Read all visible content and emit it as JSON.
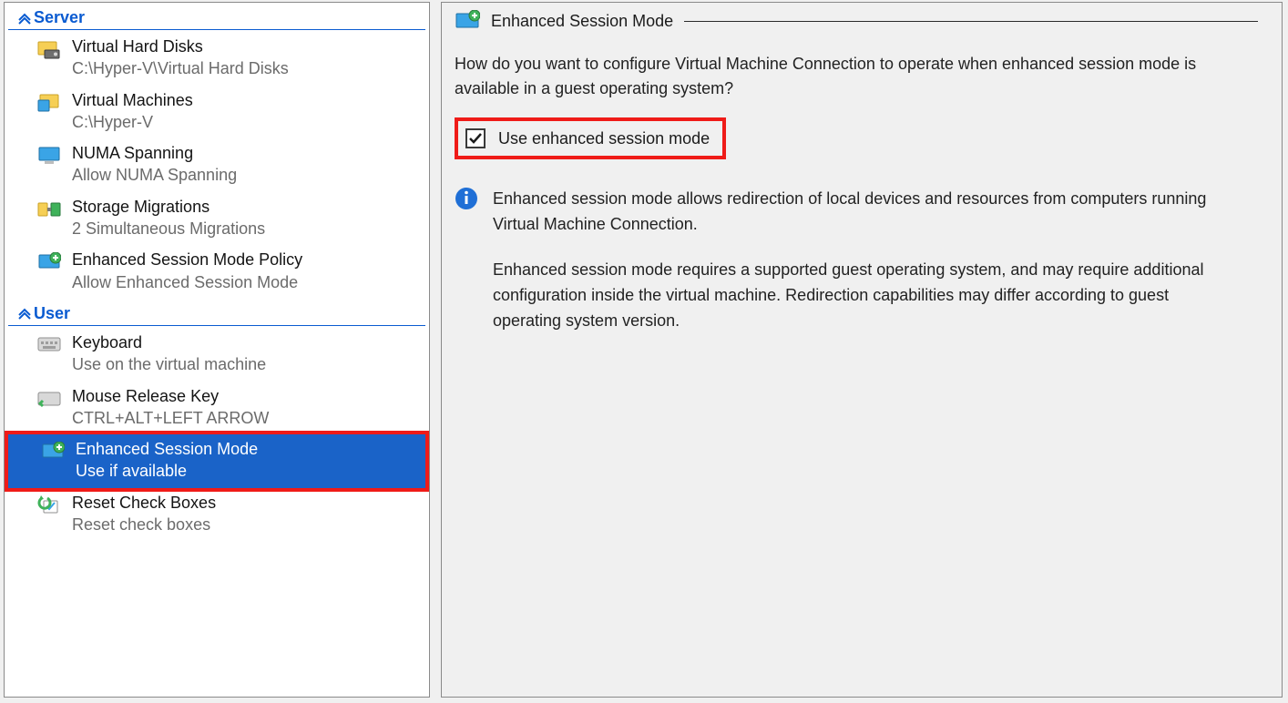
{
  "sidebar": {
    "groups": [
      {
        "id": "server",
        "title": "Server",
        "items": [
          {
            "id": "vhd",
            "title": "Virtual Hard Disks",
            "sub": "C:\\Hyper-V\\Virtual Hard Disks"
          },
          {
            "id": "vms",
            "title": "Virtual Machines",
            "sub": "C:\\Hyper-V"
          },
          {
            "id": "numa",
            "title": "NUMA Spanning",
            "sub": "Allow NUMA Spanning"
          },
          {
            "id": "stor",
            "title": "Storage Migrations",
            "sub": "2 Simultaneous Migrations"
          },
          {
            "id": "esmp",
            "title": "Enhanced Session Mode Policy",
            "sub": "Allow Enhanced Session Mode"
          }
        ]
      },
      {
        "id": "user",
        "title": "User",
        "items": [
          {
            "id": "kbd",
            "title": "Keyboard",
            "sub": "Use on the virtual machine"
          },
          {
            "id": "mrk",
            "title": "Mouse Release Key",
            "sub": "CTRL+ALT+LEFT ARROW"
          },
          {
            "id": "esm",
            "title": "Enhanced Session Mode",
            "sub": "Use if available",
            "selected": true,
            "annotated": true
          },
          {
            "id": "rcb",
            "title": "Reset Check Boxes",
            "sub": "Reset check boxes"
          }
        ]
      }
    ]
  },
  "panel": {
    "heading": "Enhanced Session Mode",
    "question": "How do you want to configure Virtual Machine Connection to operate when enhanced session mode is available in a guest operating system?",
    "checkbox_label": "Use enhanced session mode",
    "checkbox_checked": true,
    "info_p1": "Enhanced session mode allows redirection of local devices and resources from computers running Virtual Machine Connection.",
    "info_p2": "Enhanced session mode requires a supported guest operating system, and may require additional configuration inside the virtual machine. Redirection capabilities may differ according to guest operating system version."
  }
}
